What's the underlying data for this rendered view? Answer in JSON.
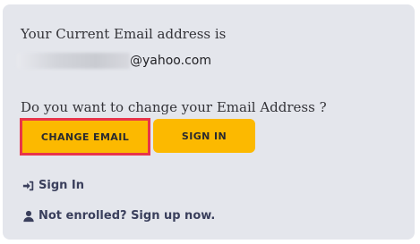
{
  "account": {
    "current_email_label": "Your Current Email address is",
    "email_visible_part": "@yahoo.com",
    "change_prompt": "Do you want to change your Email Address ?"
  },
  "actions": {
    "change_email_label": "CHANGE EMAIL",
    "sign_in_label": "SIGN IN"
  },
  "links": {
    "sign_in": {
      "label": "Sign In",
      "icon": "sign-in-icon"
    },
    "sign_up": {
      "label": "Not enrolled? Sign up now.",
      "icon": "user-icon"
    }
  },
  "colors": {
    "panel_background": "#e4e6ec",
    "button_accent": "#fcb900",
    "highlight_border": "#e8344a",
    "link_text": "#3a3f5c"
  }
}
